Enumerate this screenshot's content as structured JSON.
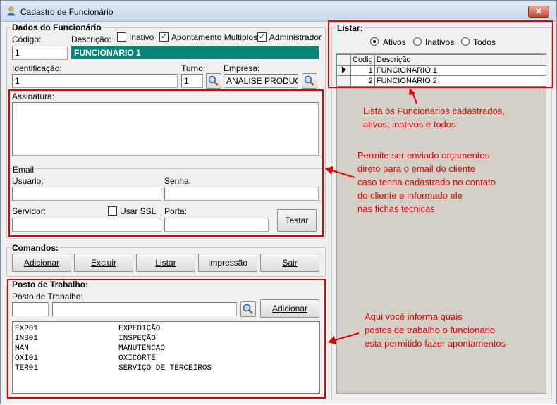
{
  "window": {
    "title": "Cadastro de Funcionário",
    "close": "✕"
  },
  "dados": {
    "group_title": "Dados do Funcionário",
    "codigo_label": "Código:",
    "codigo_value": "1",
    "descricao_label": "Descrição:",
    "descricao_value": "FUNCIONARIO 1",
    "inativo_label": "Inativo",
    "inativo_checked": false,
    "apontamento_label": "Apontamento Multiplos",
    "apontamento_checked": true,
    "administrador_label": "Administrador",
    "administrador_checked": true,
    "identificacao_label": "Identificação:",
    "identificacao_value": "1",
    "turno_label": "Turno:",
    "turno_value": "1",
    "empresa_label": "Empresa:",
    "empresa_value": "ANALISE PRODUÇÃO",
    "assinatura_label": "Assinatura:",
    "assinatura_value": "|"
  },
  "email": {
    "group_title": "Email",
    "usuario_label": "Usuario:",
    "senha_label": "Senha:",
    "servidor_label": "Servidor:",
    "ssl_label": "Usar SSL",
    "ssl_checked": false,
    "porta_label": "Porta:",
    "testar_label": "Testar"
  },
  "comandos": {
    "group_title": "Comandos:",
    "buttons": [
      "Adicionar",
      "Excluir",
      "Listar",
      "Impressão",
      "Sair"
    ]
  },
  "posto": {
    "group_title": "Posto de Trabalho:",
    "field_label": "Posto de Trabalho:",
    "add_label": "Adicionar",
    "items": [
      {
        "code": "EXP01",
        "name": "EXPEDIÇÃO"
      },
      {
        "code": "INS01",
        "name": "INSPEÇÃO"
      },
      {
        "code": "MAN",
        "name": "MANUTENCAO"
      },
      {
        "code": "OXI01",
        "name": "OXICORTE"
      },
      {
        "code": "TER01",
        "name": "SERVIÇO DE TERCEIROS"
      }
    ]
  },
  "listar": {
    "group_title": "Listar:",
    "radio_ativos": "Ativos",
    "radio_inativos": "Inativos",
    "radio_todos": "Todos",
    "selected": "Ativos",
    "col_codigo": "Codig",
    "col_descricao": "Descrição",
    "rows": [
      {
        "codigo": "1",
        "descricao": "FUNCIONARIO 1"
      },
      {
        "codigo": "2",
        "descricao": "FUNCIONARIO 2"
      }
    ]
  },
  "notes": {
    "lista_1": "Lista os Funcionarios cadastrados,",
    "lista_2": "ativos, inativos e todos",
    "email_1": "Permite ser enviado orçamentos",
    "email_2": "direto para o email do cliente",
    "email_3": "caso tenha cadastrado no contato",
    "email_4": "do cliente e informado ele",
    "email_5": "nas fichas tecnicas",
    "posto_1": "Aqui você informa quais",
    "posto_2": "postos de trabalho o funcionario",
    "posto_3": "esta permitido fazer apontamentos"
  },
  "colors": {
    "accent": "#0a8279",
    "annotation": "#e00000",
    "grid_background": "#d4d0c8"
  },
  "icons": {
    "app": "user-icon",
    "search": "magnifier-icon",
    "row_pointer": "triangle-right-icon"
  }
}
